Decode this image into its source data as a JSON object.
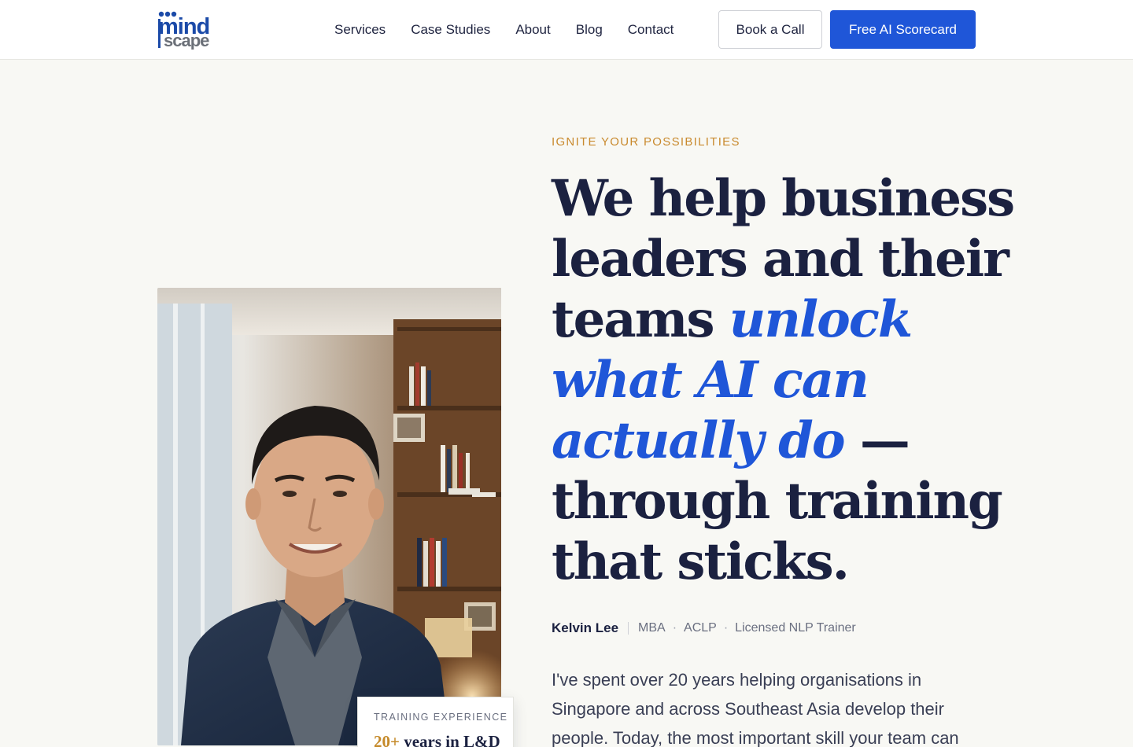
{
  "brand": {
    "logo_top": "mind",
    "logo_bottom": "scape",
    "primary_color": "#1f56d8",
    "accent_color": "#c98a2e",
    "navy": "#1b2140"
  },
  "nav": {
    "links": [
      "Services",
      "Case Studies",
      "About",
      "Blog",
      "Contact"
    ],
    "book_call": "Book a Call",
    "scorecard": "Free AI Scorecard"
  },
  "hero": {
    "eyebrow": "IGNITE YOUR POSSIBILITIES",
    "headline": {
      "l1": "We help business",
      "l2": "leaders and their",
      "l3_plain": "teams ",
      "l3_accent": "unlock",
      "l4_accent": "what AI can",
      "l5_accent": "actually do",
      "l5_plain": " —",
      "l6": "through training",
      "l7": "that sticks."
    },
    "person": {
      "name": "Kelvin Lee",
      "credentials": [
        "MBA",
        "ACLP",
        "Licensed NLP Trainer"
      ]
    },
    "body": "I've spent over 20 years helping organisations in Singapore and across Southeast Asia develop their people. Today, the most important skill your team can"
  },
  "experience_card": {
    "label": "TRAINING EXPERIENCE",
    "number": "20+",
    "text": " years in L&D"
  }
}
